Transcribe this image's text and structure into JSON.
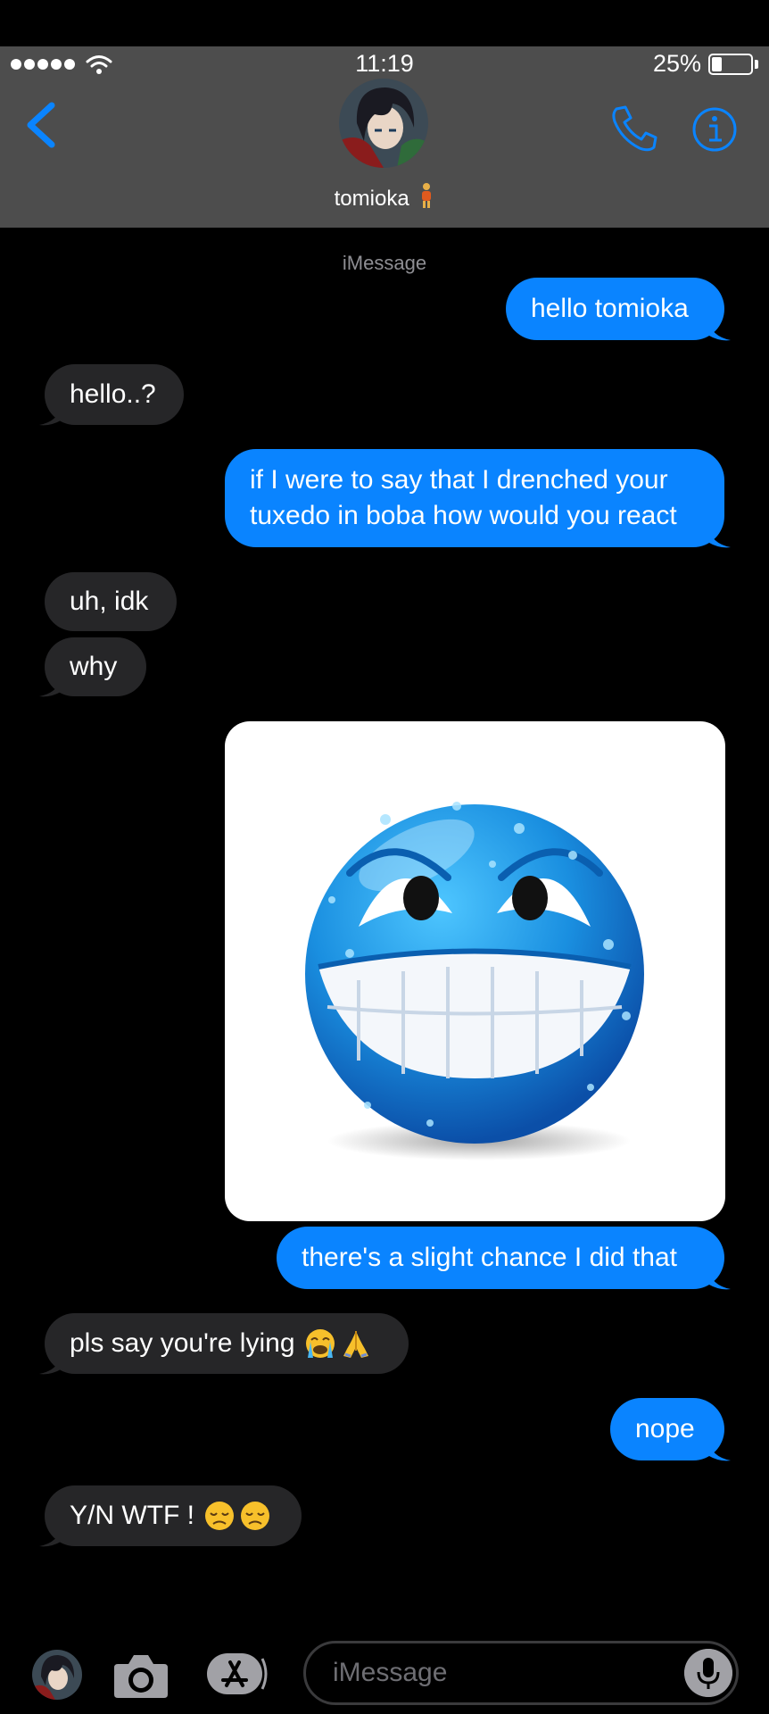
{
  "status_bar": {
    "time": "11:19",
    "battery_percent": "25%",
    "battery_level": 0.25
  },
  "header": {
    "contact_name": "tomioka",
    "accent_color": "#0a84ff",
    "background_color": "#4d4d4d"
  },
  "thread": {
    "service_label": "iMessage",
    "messages": [
      {
        "direction": "outgoing",
        "text": "hello tomioka"
      },
      {
        "direction": "incoming",
        "text": "hello..?"
      },
      {
        "direction": "outgoing",
        "lines": [
          "if I were to say that I drenched your",
          "tuxedo in boba how would you react"
        ]
      },
      {
        "direction": "incoming",
        "text": "uh, idk"
      },
      {
        "direction": "incoming",
        "text": "why"
      },
      {
        "direction": "outgoing",
        "type": "image",
        "image": "blue-grinning-sweating-emoji"
      },
      {
        "direction": "outgoing",
        "text": "there's a slight chance I did that"
      },
      {
        "direction": "incoming",
        "text": "pls say you're lying",
        "emoji": [
          "loudly-crying-face",
          "folded-hands"
        ]
      },
      {
        "direction": "outgoing",
        "text": "nope"
      },
      {
        "direction": "incoming",
        "text": "Y/N WTF !",
        "emoji": [
          "disappointed-face",
          "disappointed-face"
        ]
      }
    ]
  },
  "composer": {
    "placeholder": "iMessage"
  }
}
